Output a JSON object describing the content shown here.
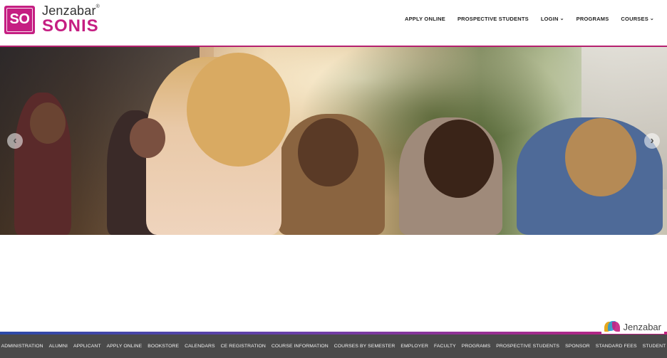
{
  "brand": {
    "badge": "SO",
    "company": "Jenzabar",
    "trademark": "®",
    "product": "SONIS"
  },
  "nav": {
    "items": [
      {
        "label": "APPLY ONLINE",
        "has_dropdown": false
      },
      {
        "label": "PROSPECTIVE STUDENTS",
        "has_dropdown": false
      },
      {
        "label": "LOGIN",
        "has_dropdown": true
      },
      {
        "label": "PROGRAMS",
        "has_dropdown": false
      },
      {
        "label": "COURSES",
        "has_dropdown": true
      }
    ],
    "caret_glyph": "⌄"
  },
  "carousel": {
    "prev_glyph": "‹",
    "next_glyph": "›"
  },
  "footer_logo": {
    "text": "Jenzabar"
  },
  "footer": {
    "links": [
      "ADMINISTRATION",
      "ALUMNI",
      "APPLICANT",
      "APPLY ONLINE",
      "BOOKSTORE",
      "CALENDARS",
      "CE REGISTRATION",
      "COURSE INFORMATION",
      "COURSES BY SEMESTER",
      "EMPLOYER",
      "FACULTY",
      "PROGRAMS",
      "PROSPECTIVE STUDENTS",
      "SPONSOR",
      "STANDARD FEES",
      "STUDENT"
    ]
  },
  "colors": {
    "brand_magenta": "#c51e82",
    "header_rule": "#b5206f",
    "footer_bg": "#4a4a4a"
  }
}
